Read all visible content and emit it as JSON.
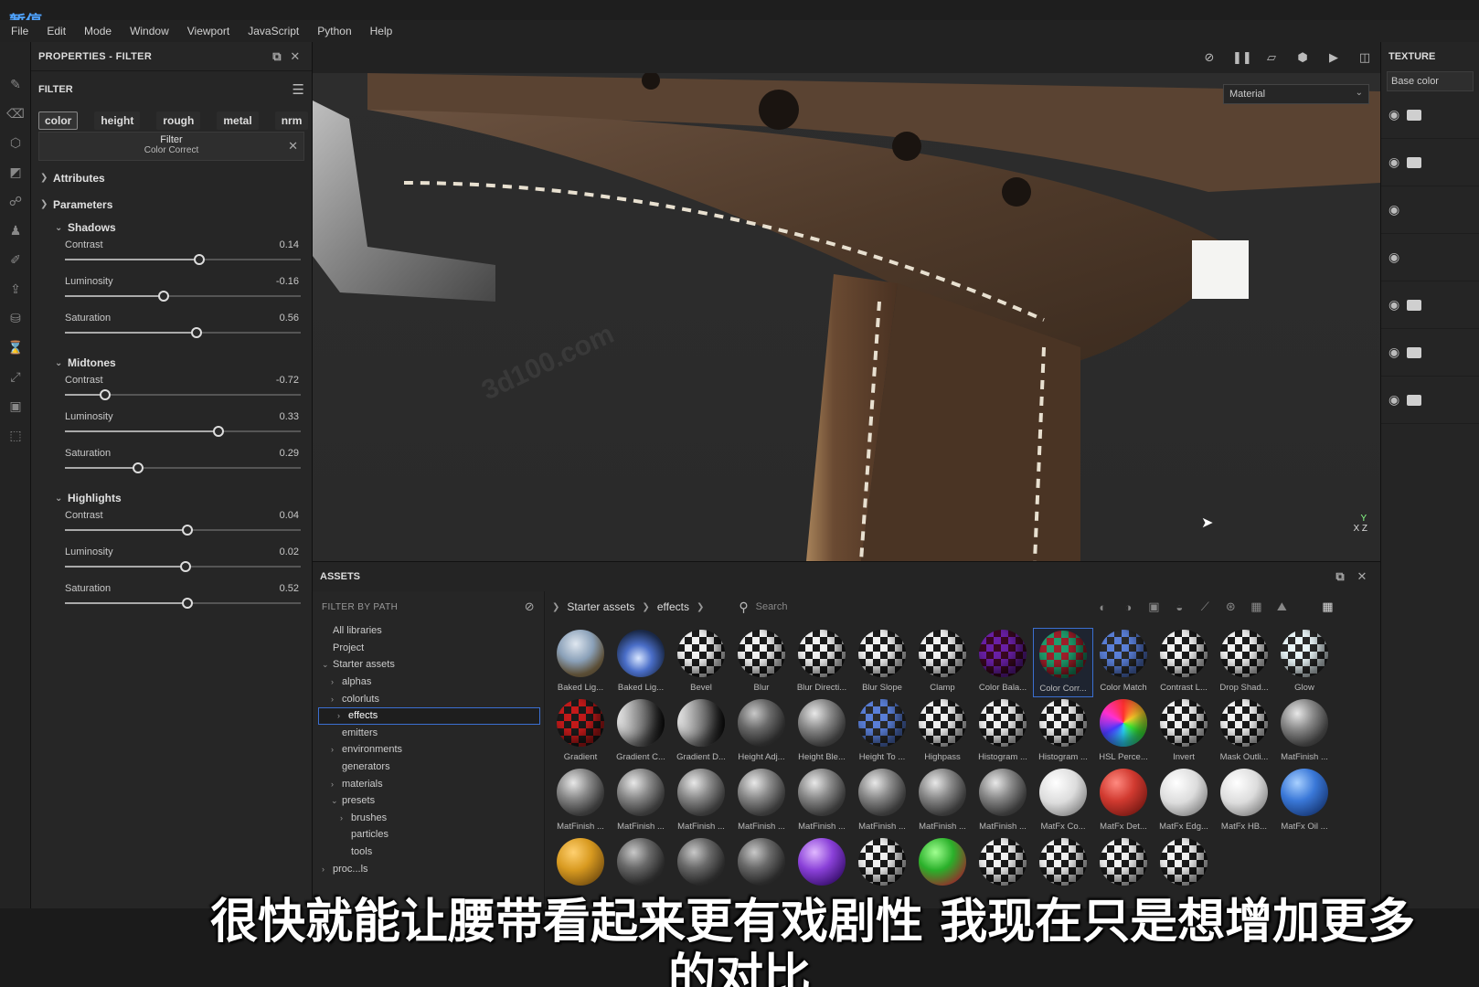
{
  "overlay": {
    "pause_label": "暂停"
  },
  "menu": [
    "File",
    "Edit",
    "Mode",
    "Window",
    "Viewport",
    "JavaScript",
    "Python",
    "Help"
  ],
  "properties": {
    "title": "PROPERTIES - FILTER",
    "section_label": "FILTER",
    "channels": [
      {
        "label": "color",
        "active": true
      },
      {
        "label": "height",
        "active": false
      },
      {
        "label": "rough",
        "active": false
      },
      {
        "label": "metal",
        "active": false
      },
      {
        "label": "nrm",
        "active": false
      }
    ],
    "filter_box": {
      "line1": "Filter",
      "line2": "Color Correct"
    },
    "attributes_label": "Attributes",
    "parameters_label": "Parameters",
    "groups": [
      {
        "name": "Shadows",
        "params": [
          {
            "label": "Contrast",
            "value": "0.14",
            "pos": 0.57
          },
          {
            "label": "Luminosity",
            "value": "-0.16",
            "pos": 0.42
          },
          {
            "label": "Saturation",
            "value": "0.56",
            "pos": 0.56
          }
        ]
      },
      {
        "name": "Midtones",
        "params": [
          {
            "label": "Contrast",
            "value": "-0.72",
            "pos": 0.17
          },
          {
            "label": "Luminosity",
            "value": "0.33",
            "pos": 0.65
          },
          {
            "label": "Saturation",
            "value": "0.29",
            "pos": 0.31
          }
        ]
      },
      {
        "name": "Highlights",
        "params": [
          {
            "label": "Contrast",
            "value": "0.04",
            "pos": 0.52
          },
          {
            "label": "Luminosity",
            "value": "0.02",
            "pos": 0.51
          },
          {
            "label": "Saturation",
            "value": "0.52",
            "pos": 0.52
          }
        ]
      }
    ]
  },
  "viewport": {
    "material_select": "Material",
    "axis_labels": {
      "y": "Y",
      "x": "X",
      "z": "Z"
    },
    "watermark": "3d100.com"
  },
  "texture": {
    "title": "TEXTURE",
    "base_color": "Base color"
  },
  "assets": {
    "title": "ASSETS",
    "filter_by_path": "FILTER BY PATH",
    "tree": [
      {
        "label": "All libraries",
        "indent": 0,
        "chev": ""
      },
      {
        "label": "Project",
        "indent": 0,
        "chev": ""
      },
      {
        "label": "Starter assets",
        "indent": 0,
        "chev": "open"
      },
      {
        "label": "alphas",
        "indent": 1,
        "chev": "closed"
      },
      {
        "label": "colorluts",
        "indent": 1,
        "chev": "closed"
      },
      {
        "label": "effects",
        "indent": 1,
        "chev": "closed",
        "selected": true
      },
      {
        "label": "emitters",
        "indent": 1,
        "chev": ""
      },
      {
        "label": "environments",
        "indent": 1,
        "chev": "closed"
      },
      {
        "label": "generators",
        "indent": 1,
        "chev": ""
      },
      {
        "label": "materials",
        "indent": 1,
        "chev": "closed"
      },
      {
        "label": "presets",
        "indent": 1,
        "chev": "open"
      },
      {
        "label": "brushes",
        "indent": 2,
        "chev": "closed"
      },
      {
        "label": "particles",
        "indent": 2,
        "chev": ""
      },
      {
        "label": "tools",
        "indent": 2,
        "chev": ""
      },
      {
        "label": "proc...ls",
        "indent": 0,
        "chev": "closed"
      }
    ],
    "breadcrumb": [
      "Starter assets",
      "effects"
    ],
    "search_placeholder": "Search",
    "items": [
      {
        "label": "Baked Lig...",
        "style": "b-sky"
      },
      {
        "label": "Baked Lig...",
        "style": "b-blue"
      },
      {
        "label": "Bevel",
        "style": "b-check"
      },
      {
        "label": "Blur",
        "style": "b-check"
      },
      {
        "label": "Blur Directi...",
        "style": "b-check"
      },
      {
        "label": "Blur Slope",
        "style": "b-check"
      },
      {
        "label": "Clamp",
        "style": "b-check"
      },
      {
        "label": "Color Bala...",
        "style": "b-check-purple"
      },
      {
        "label": "Color Corr...",
        "style": "b-check-green",
        "selected": true
      },
      {
        "label": "Color Match",
        "style": "b-check-blue"
      },
      {
        "label": "Contrast L...",
        "style": "b-check"
      },
      {
        "label": "Drop Shad...",
        "style": "b-check"
      },
      {
        "label": "Glow",
        "style": "b-check-cyan"
      },
      {
        "label": "Gradient",
        "style": "b-check-red"
      },
      {
        "label": "Gradient C...",
        "style": "b-grad"
      },
      {
        "label": "Gradient D...",
        "style": "b-grad"
      },
      {
        "label": "Height Adj...",
        "style": "b-metal-dark"
      },
      {
        "label": "Height Ble...",
        "style": "b-metal"
      },
      {
        "label": "Height To ...",
        "style": "b-check-blue"
      },
      {
        "label": "Highpass",
        "style": "b-check"
      },
      {
        "label": "Histogram ...",
        "style": "b-check"
      },
      {
        "label": "Histogram ...",
        "style": "b-check"
      },
      {
        "label": "HSL Perce...",
        "style": "b-hsl"
      },
      {
        "label": "Invert",
        "style": "b-check"
      },
      {
        "label": "Mask Outli...",
        "style": "b-check"
      },
      {
        "label": "MatFinish ...",
        "style": "b-metal"
      },
      {
        "label": "MatFinish ...",
        "style": "b-metal"
      },
      {
        "label": "MatFinish ...",
        "style": "b-metal"
      },
      {
        "label": "MatFinish ...",
        "style": "b-metal"
      },
      {
        "label": "MatFinish ...",
        "style": "b-metal"
      },
      {
        "label": "MatFinish ...",
        "style": "b-metal"
      },
      {
        "label": "MatFinish ...",
        "style": "b-metal"
      },
      {
        "label": "MatFinish ...",
        "style": "b-metal"
      },
      {
        "label": "MatFinish ...",
        "style": "b-metal"
      },
      {
        "label": "MatFx Co...",
        "style": "b-white"
      },
      {
        "label": "MatFx Det...",
        "style": "b-red"
      },
      {
        "label": "MatFx Edg...",
        "style": "b-white"
      },
      {
        "label": "MatFx HB...",
        "style": "b-white"
      },
      {
        "label": "MatFx Oil ...",
        "style": "b-blue2"
      },
      {
        "label": "",
        "style": "b-orange"
      },
      {
        "label": "",
        "style": "b-metal-dark"
      },
      {
        "label": "",
        "style": "b-metal-dark"
      },
      {
        "label": "",
        "style": "b-metal-dark"
      },
      {
        "label": "",
        "style": "b-violet"
      },
      {
        "label": "",
        "style": "b-check"
      },
      {
        "label": "",
        "style": "b-green"
      },
      {
        "label": "",
        "style": "b-check"
      },
      {
        "label": "",
        "style": "b-check"
      },
      {
        "label": "",
        "style": "b-check"
      },
      {
        "label": "",
        "style": "b-check"
      }
    ]
  },
  "subtitle": {
    "line1": "很快就能让腰带看起来更有戏剧性 我现在只是想增加更多",
    "line2": "的对比"
  }
}
